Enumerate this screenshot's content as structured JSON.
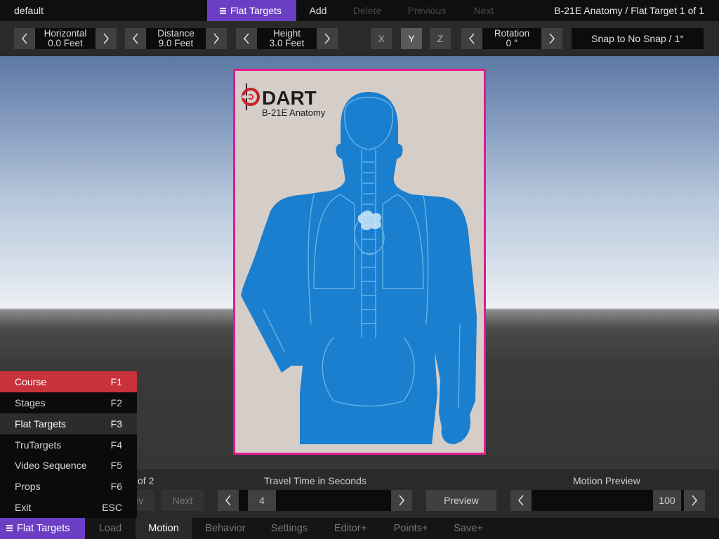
{
  "topbar": {
    "doc_name": "default",
    "menu": {
      "flat_targets": "Flat Targets",
      "add": "Add",
      "delete": "Delete",
      "previous": "Previous",
      "next": "Next"
    },
    "breadcrumb": "B-21E Anatomy / Flat Target 1 of 1"
  },
  "controls": {
    "horizontal": {
      "label": "Horizontal",
      "value": "0.0 Feet"
    },
    "distance": {
      "label": "Distance",
      "value": "9.0 Feet"
    },
    "height": {
      "label": "Height",
      "value": "3.0 Feet"
    },
    "axes": [
      "X",
      "Y",
      "Z"
    ],
    "selected_axis": "Y",
    "rotation": {
      "label": "Rotation",
      "value": "0 °"
    },
    "snap": "Snap to No Snap / 1°"
  },
  "target": {
    "brand": "DART",
    "model": "B-21E Anatomy",
    "colors": {
      "frame": "#e2198f",
      "silhouette": "#1a7fcf",
      "paper": "#d4cdc8",
      "brand_red": "#c8202a"
    }
  },
  "lower_panel": {
    "page_of": "of 2",
    "prev_label": "Prev",
    "next_label": "Next",
    "travel_label": "Travel Time in Seconds",
    "travel_value": "4",
    "preview_label": "Preview",
    "motion_preview_label": "Motion Preview",
    "motion_preview_value": "100"
  },
  "popup_menu": [
    {
      "label": "Course",
      "key": "F1",
      "state": "hot"
    },
    {
      "label": "Stages",
      "key": "F2",
      "state": ""
    },
    {
      "label": "Flat Targets",
      "key": "F3",
      "state": "highlighted"
    },
    {
      "label": "TruTargets",
      "key": "F4",
      "state": ""
    },
    {
      "label": "Video Sequence",
      "key": "F5",
      "state": ""
    },
    {
      "label": "Props",
      "key": "F6",
      "state": ""
    },
    {
      "label": "Exit",
      "key": "ESC",
      "state": ""
    }
  ],
  "bottom_tabs": {
    "main": "Flat Targets",
    "load": "Load",
    "motion": "Motion",
    "behavior": "Behavior",
    "settings": "Settings",
    "editor": "Editor+",
    "points": "Points+",
    "save": "Save+"
  }
}
